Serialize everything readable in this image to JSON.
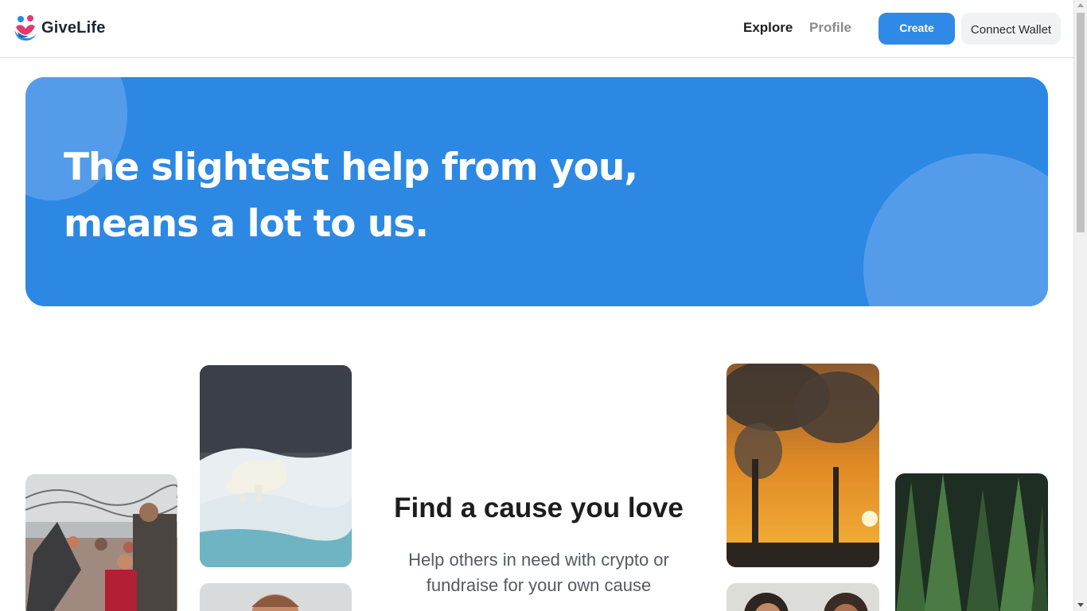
{
  "header": {
    "logo_text": "GiveLife",
    "nav": {
      "explore": "Explore",
      "profile": "Profile"
    },
    "create_label": "Create",
    "wallet_label": "Connect Wallet"
  },
  "hero": {
    "title_line1": "The slightest help from you,",
    "title_line2": "means a lot to us."
  },
  "cause": {
    "title": "Find a cause you love",
    "subtitle_line1": "Help others in need with crypto or",
    "subtitle_line2": "fundraise for your own cause"
  },
  "photos": [
    "refugee-photo",
    "polar-bear-photo",
    "person-photo",
    "factory-smoke-photo",
    "people-photo",
    "forest-photo"
  ],
  "colors": {
    "accent": "#2c88e3",
    "hero_circle": "#549ce9",
    "create_button": "#2f89e6"
  }
}
